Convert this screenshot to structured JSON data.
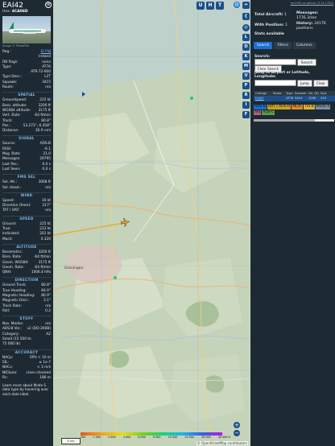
{
  "aircraft": {
    "callsign": "EAI42",
    "hex_label": "Hex:",
    "hex": "4CA06D",
    "photo_credit": "Image © PlanePlat",
    "close_glyph": "⊗"
  },
  "info": [
    {
      "k": "Reg.:",
      "v": "EI-FNJ",
      "link": true
    },
    {
      "k": "",
      "v": "Ireland"
    },
    {
      "k": "DB flags:",
      "v": "none"
    },
    {
      "k": "Type:",
      "v": "AT76"
    },
    {
      "k": "",
      "v": "ATR-72-600"
    },
    {
      "k": "Type Desc.:",
      "v": "L2T"
    },
    {
      "k": "Squawk:",
      "v": "3415"
    },
    {
      "k": "Route:",
      "v": "n/a"
    }
  ],
  "sections": [
    {
      "title": "SPATIAL",
      "rows": [
        {
          "k": "Groundspeed:",
          "v": "225 kt"
        },
        {
          "k": "Baro. altitude:",
          "v": "3200 ft"
        },
        {
          "k": "WGS84 altitude:",
          "v": "3175 ft"
        },
        {
          "k": "Vert. Rate:",
          "v": "-64 ft/min"
        },
        {
          "k": "Track:",
          "v": "80.8°"
        },
        {
          "k": "Pos.:",
          "v": "53.273°, 6.458°"
        },
        {
          "k": "Distance:",
          "v": "26.9 nmi"
        }
      ]
    },
    {
      "title": "SIGNAL",
      "rows": [
        {
          "k": "Source:",
          "v": "ADS-B"
        },
        {
          "k": "RSSI:",
          "v": "-6.1"
        },
        {
          "k": "Msg. Rate:",
          "v": "21.0"
        },
        {
          "k": "Messages:",
          "v": "29795"
        },
        {
          "k": "",
          "v": ""
        },
        {
          "k": "Last Pos.:",
          "v": "0.0 s"
        },
        {
          "k": "Last Seen:",
          "v": "0.0 s"
        }
      ]
    },
    {
      "title": "FMS SEL",
      "rows": [
        {
          "k": "Sel. Alt.:",
          "v": "3008 ft"
        },
        {
          "k": "Sel. Head.:",
          "v": "n/a"
        }
      ]
    },
    {
      "title": "WIND",
      "rows": [
        {
          "k": "Speed:",
          "v": "16 kt"
        },
        {
          "k": "Direction (from):",
          "v": "217°"
        },
        {
          "k": "TAT / OAT:",
          "v": "n/a"
        }
      ]
    },
    {
      "title": "SPEED",
      "rows": [
        {
          "k": "Ground:",
          "v": "225 kt"
        },
        {
          "k": "True:",
          "v": "212 kt"
        },
        {
          "k": "Indicated:",
          "v": "201 kt"
        },
        {
          "k": "Mach:",
          "v": "0.320"
        }
      ]
    },
    {
      "title": "ALTITUDE",
      "rows": [
        {
          "k": "Barometric:",
          "v": "3200 ft"
        },
        {
          "k": "Baro. Rate:",
          "v": "-64 ft/min"
        },
        {
          "k": "Geom. WGS84:",
          "v": "3175 ft"
        },
        {
          "k": "Geom. Rate:",
          "v": "-64 ft/min"
        },
        {
          "k": "QNH:",
          "v": "1006.4 hPa"
        }
      ]
    },
    {
      "title": "DIRECTION",
      "rows": [
        {
          "k": "Ground Track:",
          "v": "80.8°"
        },
        {
          "k": "True Heading:",
          "v": "84.0°"
        },
        {
          "k": "Magnetic Heading:",
          "v": "80.9°"
        },
        {
          "k": "Magnetic Decl.:",
          "v": "3.1°"
        },
        {
          "k": "Track Rate:",
          "v": "n/a"
        },
        {
          "k": "Roll:",
          "v": "0.2"
        }
      ]
    },
    {
      "title": "STUFF",
      "rows": [
        {
          "k": "Nav. Modes:",
          "v": "n/a"
        },
        {
          "k": "ADS-B Ver.:",
          "v": "v2 (DO-260B)"
        },
        {
          "k": "Category:",
          "v": "A2"
        },
        {
          "k": "Small (15 500 to",
          "v": ""
        },
        {
          "k": "75 000 lb)",
          "v": ""
        }
      ]
    },
    {
      "title": "ACCURACY",
      "rows": [
        {
          "k": "NACp:",
          "v": "EPU < 10 m"
        },
        {
          "k": "SIL:",
          "v": "≤ 1e-7"
        },
        {
          "k": "NACv:",
          "v": "< 3 m/s"
        },
        {
          "k": "NICbaro:",
          "v": "cross-checked"
        },
        {
          "k": "Rc:",
          "v": "186 m"
        }
      ]
    }
  ],
  "footer_note": "Learn more about Mode S data type by hovering over each data label.",
  "map": {
    "top_buttons": [
      "U",
      "H",
      "T"
    ],
    "side_buttons": [
      "L",
      "O",
      "K",
      "M",
      "V",
      "P",
      "R",
      "I",
      "F"
    ],
    "scale": "5 nm",
    "altitude_ticks": [
      "500",
      "1 000",
      "2 000",
      "4 000",
      "6 000",
      "8 000",
      "10 000",
      "20 000",
      "30 000",
      "40 000 ft"
    ],
    "attribution": "© OpenStreetMap contributors",
    "place_label": "Groningen"
  },
  "sidebar": {
    "top_link": "tar1090 on github (3.14.1755)",
    "stats": {
      "total_label": "Total Aircraft:",
      "total": "1",
      "messages_label": "Messages:",
      "messages": "1735.3/sec",
      "position_label": "With Position:",
      "position": "1",
      "history_label": "History:",
      "history": "24176 positions"
    },
    "stats_available": "Stats available",
    "tabs": [
      "Search",
      "Filters",
      "Columns"
    ],
    "search_label": "Search:",
    "search_placeholder": "",
    "search_button": "Search",
    "clear_search_button": "Clear Search",
    "jump_label": "Jump to Airport or Latitude, Longitude:",
    "jump_button": "Jump",
    "clear_button": "Clear",
    "table": {
      "headers": [
        "Callsign",
        "Route",
        "Type",
        "Squawk",
        "Alt. (ft)",
        "Spd."
      ],
      "rows": [
        [
          "EAI42",
          "",
          "AT76",
          "3415",
          "3200",
          "225"
        ]
      ]
    },
    "badges": [
      {
        "label": "ADS-B",
        "color": "#1d6fd1"
      },
      {
        "label": "UAT / ADS-R",
        "color": "#c9a227"
      },
      {
        "label": "MLAT",
        "color": "#d98b2b"
      },
      {
        "label": "TIS-B",
        "color": "#d9b23b"
      },
      {
        "label": "Mode-S",
        "color": "#7c8fa0"
      },
      {
        "label": "AIS",
        "color": "#b0607a"
      },
      {
        "label": "ADS-C",
        "color": "#5a9a4a"
      }
    ]
  }
}
